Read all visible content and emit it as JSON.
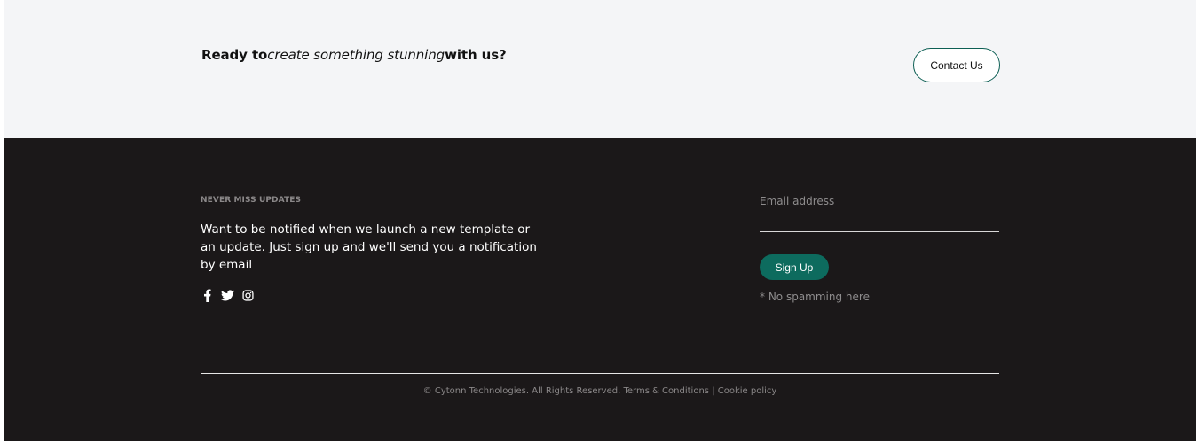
{
  "cta": {
    "lead_bold": "Ready to",
    "italic": "create something stunning",
    "tail_bold": "with us?",
    "button_label": "Contact Us"
  },
  "footer": {
    "updates_heading": "NEVER MISS UPDATES",
    "updates_description": "Want to be notified when we launch a new template or an update. Just sign up and we'll send you a notification by email",
    "social_icons": [
      "facebook-icon",
      "twitter-icon",
      "instagram-icon"
    ],
    "email_placeholder": "Email address",
    "signup_label": "Sign Up",
    "no_spam_text": "* No spamming here",
    "copyright_text": "© Cytonn Technologies. All Rights Reserved.",
    "terms_link": "Terms & Conditions",
    "separator": "|",
    "cookie_link": "Cookie policy"
  },
  "colors": {
    "cta_background": "#f4f5f7",
    "footer_background": "#1b1819",
    "accent_green": "#0d6b5e",
    "muted_text": "#8b8889"
  }
}
